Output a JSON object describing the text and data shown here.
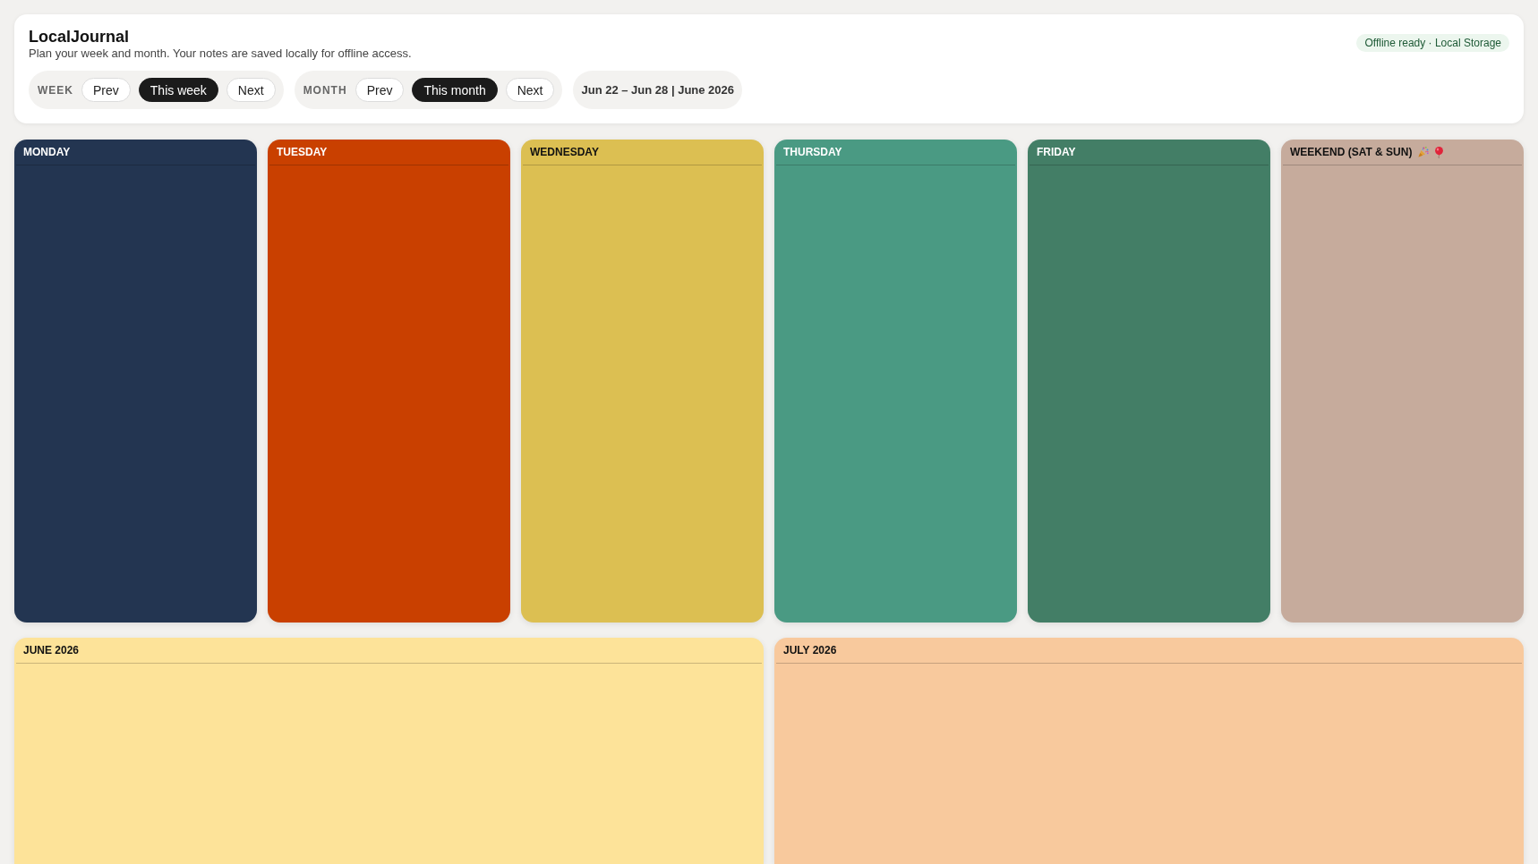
{
  "header": {
    "title": "LocalJournal",
    "subtitle": "Plan your week and month. Your notes are saved locally for offline access.",
    "status": "Offline ready · Local Storage",
    "nav_groups": [
      {
        "label": "WEEK",
        "buttons": [
          {
            "label": "Prev",
            "selected": false
          },
          {
            "label": "This week",
            "selected": true
          },
          {
            "label": "Next",
            "selected": false
          }
        ]
      },
      {
        "label": "MONTH",
        "buttons": [
          {
            "label": "Prev",
            "selected": false
          },
          {
            "label": "This month",
            "selected": true
          },
          {
            "label": "Next",
            "selected": false
          }
        ]
      }
    ],
    "range": "Jun 22 – Jun 28 | June 2026"
  },
  "days": [
    {
      "title": "MONDAY",
      "kind": "weekday",
      "color": "#233551"
    },
    {
      "title": "TUESDAY",
      "kind": "weekday",
      "color": "#c94000"
    },
    {
      "title": "WEDNESDAY",
      "kind": "weekday",
      "color": "#dcbf52"
    },
    {
      "title": "THURSDAY",
      "kind": "weekday",
      "color": "#4a9a83"
    },
    {
      "title": "FRIDAY",
      "kind": "weekday",
      "color": "#437e66"
    },
    {
      "title": "WEEKEND (SAT & SUN)",
      "kind": "weekend",
      "color": "#c6ab9c"
    }
  ],
  "months": [
    {
      "title": "JUNE 2026",
      "color": "#fde399"
    },
    {
      "title": "JULY 2026",
      "color": "#f8c99d"
    }
  ]
}
